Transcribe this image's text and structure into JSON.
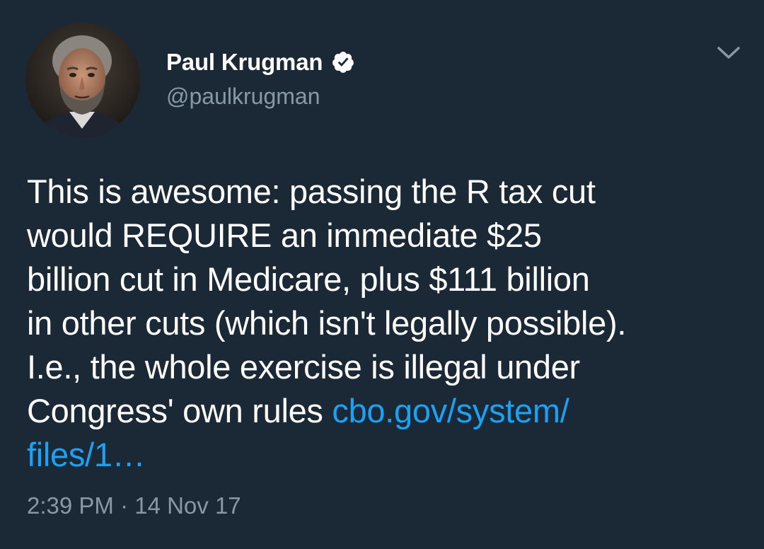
{
  "author": {
    "name": "Paul Krugman",
    "handle": "@paulkrugman",
    "verified": true,
    "avatar_icon": "person-avatar"
  },
  "menu": {
    "icon": "chevron-down-icon"
  },
  "tweet": {
    "text_lines": [
      "This is awesome: passing the R tax cut",
      "would REQUIRE an immediate $25",
      "billion cut in Medicare, plus $111 billion",
      "in other cuts (which isn't legally possible).",
      "I.e., the whole exercise is illegal under",
      "Congress' own rules "
    ],
    "link_line1": "cbo.gov/system/",
    "link_line2": "files/1…",
    "timestamp": "2:39 PM · 14 Nov 17"
  },
  "colors": {
    "background": "#1b2836",
    "text": "#ffffff",
    "secondary_text": "#8899a6",
    "link": "#1da1f2"
  }
}
